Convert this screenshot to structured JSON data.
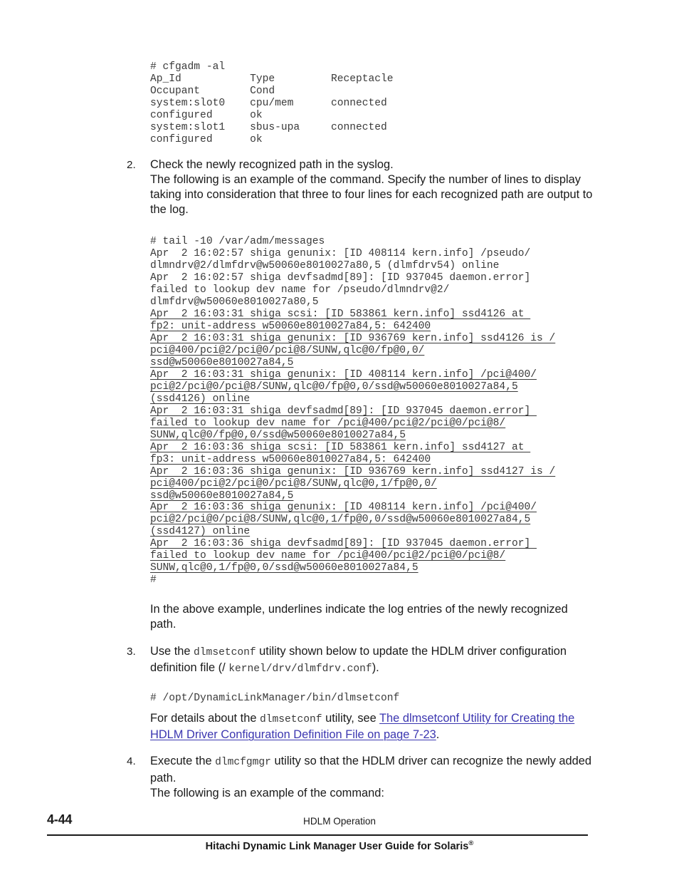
{
  "document": {
    "title": "Hitachi Dynamic Link Manager User Guide for Solaris",
    "registered_mark": "®",
    "section": "HDLM Operation",
    "page_number": "4-44"
  },
  "colors": {
    "text": "#1a1a1a",
    "code": "#3a3a3a",
    "link": "#3b36b0",
    "background": "#ffffff"
  },
  "cfgadm_block": {
    "lines": [
      "# cfgadm -al",
      "Ap_Id           Type         Receptacle",
      "Occupant        Cond",
      "system:slot0    cpu/mem      connected",
      "configured      ok",
      "system:slot1    sbus-upa     connected",
      "configured      ok"
    ]
  },
  "step2": {
    "number": "2.",
    "heading": "Check the newly recognized path in the syslog.",
    "body": "The following is an example of the command. Specify the number of lines to display taking into consideration that three to four lines for each recognized path are output to the log."
  },
  "syslog_block": {
    "lines": [
      {
        "text": "# tail -10 /var/adm/messages",
        "underlined": false
      },
      {
        "text": "Apr  2 16:02:57 shiga genunix: [ID 408114 kern.info] /pseudo/",
        "underlined": false
      },
      {
        "text": "dlmndrv@2/dlmfdrv@w50060e8010027a80,5 (dlmfdrv54) online",
        "underlined": false
      },
      {
        "text": "Apr  2 16:02:57 shiga devfsadmd[89]: [ID 937045 daemon.error]",
        "underlined": false
      },
      {
        "text": "failed to lookup dev name for /pseudo/dlmndrv@2/",
        "underlined": false
      },
      {
        "text": "dlmfdrv@w50060e8010027a80,5",
        "underlined": false
      },
      {
        "text": "Apr  2 16:03:31 shiga scsi: [ID 583861 kern.info] ssd4126 at ",
        "underlined": true
      },
      {
        "text": "fp2: unit-address w50060e8010027a84,5: 642400",
        "underlined": true
      },
      {
        "text": "Apr  2 16:03:31 shiga genunix: [ID 936769 kern.info] ssd4126 is /",
        "underlined": true
      },
      {
        "text": "pci@400/pci@2/pci@0/pci@8/SUNW,qlc@0/fp@0,0/",
        "underlined": true
      },
      {
        "text": "ssd@w50060e8010027a84,5",
        "underlined": true
      },
      {
        "text": "Apr  2 16:03:31 shiga genunix: [ID 408114 kern.info] /pci@400/",
        "underlined": true
      },
      {
        "text": "pci@2/pci@0/pci@8/SUNW,qlc@0/fp@0,0/ssd@w50060e8010027a84,5",
        "underlined": true
      },
      {
        "text": "(ssd4126) online",
        "underlined": true
      },
      {
        "text": "Apr  2 16:03:31 shiga devfsadmd[89]: [ID 937045 daemon.error] ",
        "underlined": true
      },
      {
        "text": "failed to lookup dev name for /pci@400/pci@2/pci@0/pci@8/",
        "underlined": true
      },
      {
        "text": "SUNW,qlc@0/fp@0,0/ssd@w50060e8010027a84,5",
        "underlined": true
      },
      {
        "text": "Apr  2 16:03:36 shiga scsi: [ID 583861 kern.info] ssd4127 at ",
        "underlined": true
      },
      {
        "text": "fp3: unit-address w50060e8010027a84,5: 642400",
        "underlined": true
      },
      {
        "text": "Apr  2 16:03:36 shiga genunix: [ID 936769 kern.info] ssd4127 is /",
        "underlined": true
      },
      {
        "text": "pci@400/pci@2/pci@0/pci@8/SUNW,qlc@0,1/fp@0,0/",
        "underlined": true
      },
      {
        "text": "ssd@w50060e8010027a84,5",
        "underlined": true
      },
      {
        "text": "Apr  2 16:03:36 shiga genunix: [ID 408114 kern.info] /pci@400/",
        "underlined": true
      },
      {
        "text": "pci@2/pci@0/pci@8/SUNW,qlc@0,1/fp@0,0/ssd@w50060e8010027a84,5",
        "underlined": true
      },
      {
        "text": "(ssd4127) online",
        "underlined": true
      },
      {
        "text": "Apr  2 16:03:36 shiga devfsadmd[89]: [ID 937045 daemon.error] ",
        "underlined": true
      },
      {
        "text": "failed to lookup dev name for /pci@400/pci@2/pci@0/pci@8/",
        "underlined": true
      },
      {
        "text": "SUNW,qlc@0,1/fp@0,0/ssd@w50060e8010027a84,5",
        "underlined": true
      },
      {
        "text": "#",
        "underlined": false
      }
    ]
  },
  "note_after_syslog": "In the above example, underlines indicate the log entries of the newly recognized path.",
  "step3": {
    "number": "3.",
    "text_1": "Use the ",
    "mono_1": "dlmsetconf",
    "text_2": " utility shown below to update the HDLM driver configuration definition file (/ ",
    "mono_2": "kernel/drv/dlmfdrv.conf",
    "text_3": ").",
    "command": "# /opt/DynamicLinkManager/bin/dlmsetconf",
    "details_1": "For details about the ",
    "details_mono": "dlmsetconf",
    "details_2": " utility, see ",
    "link_text": "The dlmsetconf Utility for Creating the HDLM Driver Configuration Definition File on page 7-23",
    "details_3": "."
  },
  "step4": {
    "number": "4.",
    "text_1": "Execute the ",
    "mono_1": "dlmcfgmgr",
    "text_2": " utility so that the HDLM driver can recognize the newly added path.",
    "body": "The following is an example of the command:"
  }
}
